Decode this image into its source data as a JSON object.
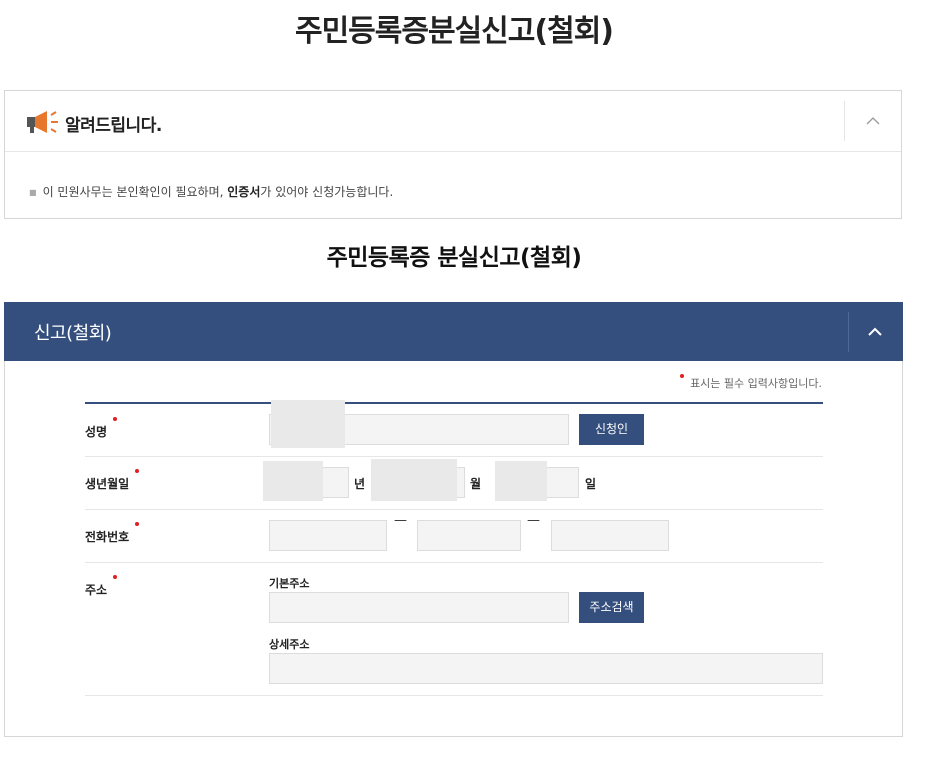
{
  "page_title": "주민등록증분실신고(철회)",
  "notice": {
    "title": "알려드립니다.",
    "text_before": "이 민원사무는 본인확인이 필요하며, ",
    "text_bold": "인증서",
    "text_after": "가 있어야 신청가능합니다."
  },
  "sub_title": "주민등록증 분실신고(철회)",
  "panel": {
    "title": "신고(철회)",
    "required_note": "표시는 필수 입력사항입니다."
  },
  "form": {
    "name_label": "성명",
    "applicant_button": "신청인",
    "birth_label": "생년월일",
    "year_unit": "년",
    "month_unit": "월",
    "day_unit": "일",
    "phone_label": "전화번호",
    "phone_sep": "—",
    "address_label": "주소",
    "basic_address_label": "기본주소",
    "address_search_button": "주소검색",
    "detail_address_label": "상세주소"
  },
  "colors": {
    "primary": "#344f7d",
    "required": "#e02020"
  },
  "icons": {
    "notice": "megaphone-icon",
    "collapse": "chevron-up-icon"
  }
}
